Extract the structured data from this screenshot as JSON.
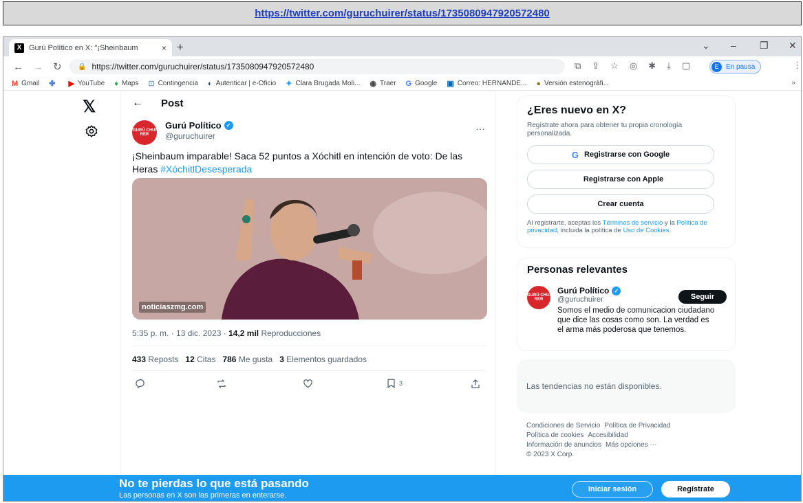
{
  "caption": {
    "url": "https://twitter.com/guruchuirer/status/1735080947920572480"
  },
  "browser": {
    "tab_title": "Gurú Político en X: \"¡Sheinbaum",
    "tab_close": "×",
    "new_tab": "+",
    "window_controls": [
      "⌄",
      "–",
      "❐",
      "✕"
    ],
    "address": "https://twitter.com/guruchuirer/status/1735080947920572480",
    "profile_initial": "E",
    "profile_status": "En pausa",
    "bookmarks": [
      {
        "icon": "M",
        "icon_color": "#ea4335",
        "label": "Gmail"
      },
      {
        "icon": "✤",
        "icon_color": "#4a7bd0",
        "label": ""
      },
      {
        "icon": "▶",
        "icon_color": "#ff0000",
        "label": "YouTube"
      },
      {
        "icon": "♦",
        "icon_color": "#34a853",
        "label": "Maps"
      },
      {
        "icon": "⊡",
        "icon_color": "#7aa2d6",
        "label": "Contingencia"
      },
      {
        "icon": "◐",
        "icon_color": "#1a3d6e",
        "label": "Autenticar | e-Oficio"
      },
      {
        "icon": "✦",
        "icon_color": "#1d9bf0",
        "label": "Clara Brugada Moli..."
      },
      {
        "icon": "◉",
        "icon_color": "#444444",
        "label": "Traer"
      },
      {
        "icon": "G",
        "icon_color": "#4285f4",
        "label": "Google"
      },
      {
        "icon": "▣",
        "icon_color": "#0a64ad",
        "label": "Correo: HERNANDE..."
      },
      {
        "icon": "●",
        "icon_color": "#9a7a2a",
        "label": "Versión estenográfi..."
      }
    ],
    "bookmarks_more": "»"
  },
  "x": {
    "header_title": "Post",
    "author": {
      "name": "Gurú Político",
      "handle": "@guruchuirer",
      "avatar_text": "GURÚ CHUI RER"
    },
    "tweet_text": "¡Sheinbaum imparable! Saca 52 puntos a Xóchitl en intención de voto: De las Heras ",
    "hashtag": "#XóchitlDesesperada",
    "media_watermark": "noticiaszmg.com",
    "meta_time": "5:35 p. m. · 13 dic. 2023 · ",
    "meta_views_count": "14,2 mil",
    "meta_views_label": " Reproducciones",
    "stats": [
      {
        "count": "433",
        "label": "Reposts"
      },
      {
        "count": "12",
        "label": "Citas"
      },
      {
        "count": "786",
        "label": "Me gusta"
      },
      {
        "count": "3",
        "label": "Elementos guardados"
      }
    ],
    "bookmark_count": "3",
    "signup": {
      "title": "¿Eres nuevo en X?",
      "subtitle": "Regístrate ahora para obtener tu propia cronología personalizada.",
      "google": "Registrarse con Google",
      "apple": "Registrarse con Apple",
      "create": "Crear cuenta",
      "terms_1": "Al registrarte, aceptas los ",
      "terms_link_1": "Términos de servicio",
      "terms_2": " y la ",
      "terms_link_2": "Política de privacidad",
      "terms_3": ", incluida la política de ",
      "terms_link_3": "Uso de Cookies",
      "terms_4": "."
    },
    "people": {
      "title": "Personas relevantes",
      "name": "Gurú Político",
      "handle": "@guruchuirer",
      "bio": "Somos el medio de comunicacion ciudadano que dice las cosas como son. La verdad es el arma más poderosa que tenemos.",
      "follow": "Seguir"
    },
    "trends_unavailable": "Las tendencias no están disponibles.",
    "footer": [
      "Condiciones de Servicio",
      "Política de Privacidad",
      "Política de cookies",
      "Accesibilidad",
      "Información de anuncios",
      "Más opciones ···",
      "© 2023 X Corp."
    ],
    "banner": {
      "title": "No te pierdas lo que está pasando",
      "subtitle": "Las personas en X son las primeras en enterarse.",
      "login": "Iniciar sesión",
      "register": "Regístrate"
    }
  }
}
